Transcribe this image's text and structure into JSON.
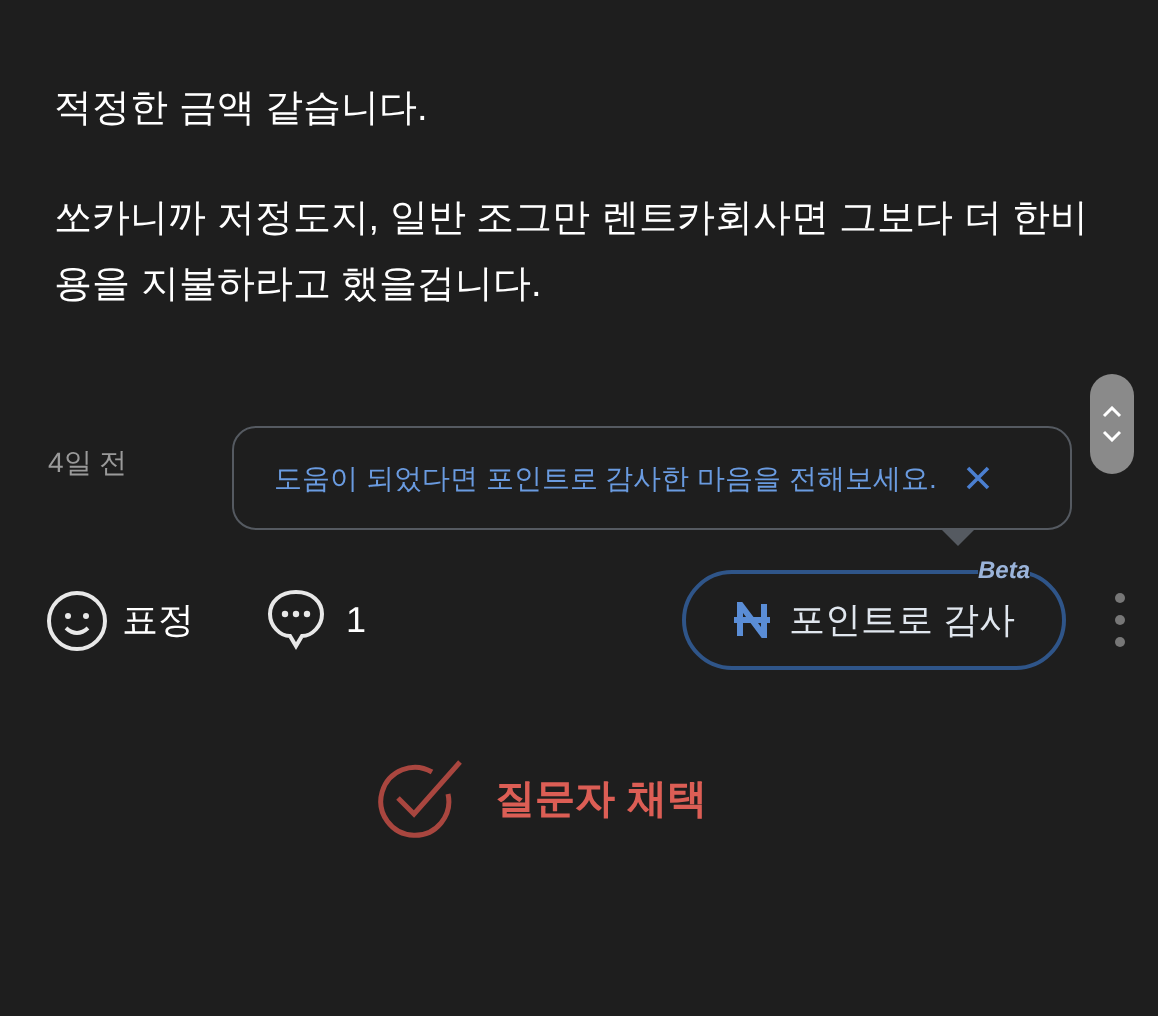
{
  "answer": {
    "paragraphs": [
      "적정한 금액 같습니다.",
      "쏘카니까 저정도지, 일반 조그만 렌트카회사면 그보다 더 한비용을 지불하라고 했을겁니다."
    ]
  },
  "time": "4일 전",
  "tooltip": {
    "text": "도움이 되었다면 포인트로 감사한 마음을 전해보세요."
  },
  "actions": {
    "emotion_label": "표정",
    "comment_count": "1",
    "thanks_button": {
      "label": "포인트로 감사",
      "badge": "Beta"
    }
  },
  "adopt_button": {
    "label": "질문자 채택"
  }
}
